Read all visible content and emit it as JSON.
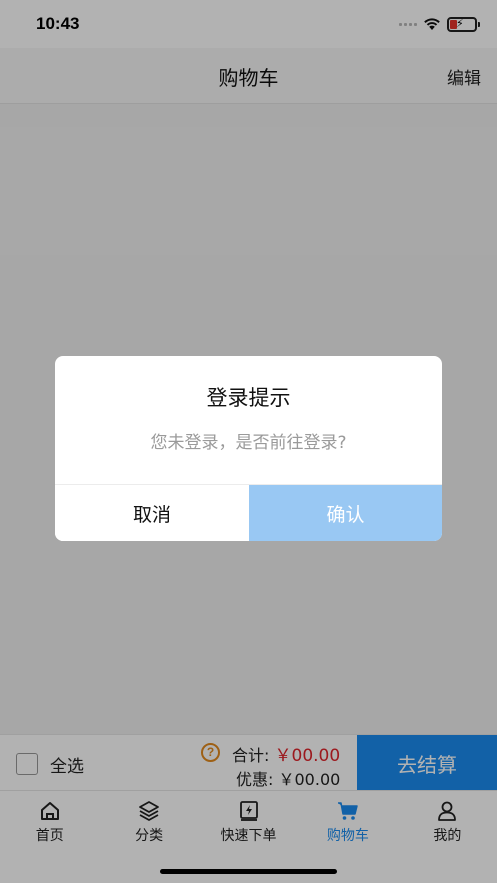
{
  "status_bar": {
    "time": "10:43"
  },
  "nav": {
    "title": "购物车",
    "edit_label": "编辑"
  },
  "checkout": {
    "select_all_label": "全选",
    "total_label": "合计:",
    "total_amount": "￥00.00",
    "discount_label": "优惠:",
    "discount_amount": "￥00.00",
    "checkout_button_label": "去结算"
  },
  "tabs": [
    {
      "label": "首页",
      "icon": "home-icon",
      "active": false
    },
    {
      "label": "分类",
      "icon": "layers-icon",
      "active": false
    },
    {
      "label": "快速下单",
      "icon": "quick-order-icon",
      "active": false
    },
    {
      "label": "购物车",
      "icon": "cart-icon",
      "active": true
    },
    {
      "label": "我的",
      "icon": "user-icon",
      "active": false
    }
  ],
  "dialog": {
    "title": "登录提示",
    "message": "您未登录，是否前往登录?",
    "cancel_label": "取消",
    "confirm_label": "确认"
  },
  "colors": {
    "accent": "#1a8cf0",
    "price_red": "#e0252c",
    "help_orange": "#e28a1f",
    "confirm_button": "#99c8f3"
  }
}
